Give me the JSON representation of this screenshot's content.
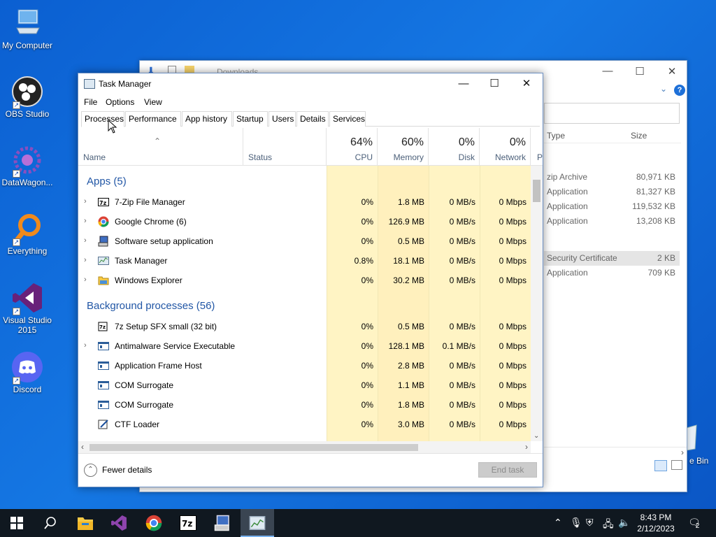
{
  "desktop": {
    "icons": [
      {
        "label": "My Computer"
      },
      {
        "label": "OBS Studio"
      },
      {
        "label": "DataWagon..."
      },
      {
        "label": "Everything"
      },
      {
        "label": "Visual Studio 2015"
      },
      {
        "label": "Discord"
      }
    ],
    "recycle_bin_label": "e Bin"
  },
  "explorer": {
    "breadcrumb": "Downloads",
    "columns": {
      "type": "Type",
      "size": "Size"
    },
    "rows": [
      {
        "type": "zip Archive",
        "size": "80,971 KB"
      },
      {
        "type": "Application",
        "size": "81,327 KB"
      },
      {
        "type": "Application",
        "size": "119,532 KB"
      },
      {
        "type": "Application",
        "size": "13,208 KB"
      },
      {
        "type": "Security Certificate",
        "size": "2 KB"
      },
      {
        "type": "Application",
        "size": "709 KB"
      }
    ]
  },
  "taskmanager": {
    "title": "Task Manager",
    "menu": [
      "File",
      "Options",
      "View"
    ],
    "tabs": [
      "Processes",
      "Performance",
      "App history",
      "Startup",
      "Users",
      "Details",
      "Services"
    ],
    "active_tab": "Processes",
    "headers": {
      "name": "Name",
      "status": "Status",
      "cpu_pct": "64%",
      "cpu": "CPU",
      "mem_pct": "60%",
      "mem": "Memory",
      "disk_pct": "0%",
      "disk": "Disk",
      "net_pct": "0%",
      "net": "Network",
      "power": "P"
    },
    "groups": {
      "apps": "Apps (5)",
      "background": "Background processes (56)"
    },
    "apps": [
      {
        "name": "7-Zip File Manager",
        "cpu": "0%",
        "mem": "1.8 MB",
        "disk": "0 MB/s",
        "net": "0 Mbps"
      },
      {
        "name": "Google Chrome (6)",
        "cpu": "0%",
        "mem": "126.9 MB",
        "disk": "0 MB/s",
        "net": "0 Mbps"
      },
      {
        "name": "Software setup application",
        "cpu": "0%",
        "mem": "0.5 MB",
        "disk": "0 MB/s",
        "net": "0 Mbps"
      },
      {
        "name": "Task Manager",
        "cpu": "0.8%",
        "mem": "18.1 MB",
        "disk": "0 MB/s",
        "net": "0 Mbps"
      },
      {
        "name": "Windows Explorer",
        "cpu": "0%",
        "mem": "30.2 MB",
        "disk": "0 MB/s",
        "net": "0 Mbps"
      }
    ],
    "background": [
      {
        "name": "7z Setup SFX small (32 bit)",
        "cpu": "0%",
        "mem": "0.5 MB",
        "disk": "0 MB/s",
        "net": "0 Mbps"
      },
      {
        "name": "Antimalware Service Executable",
        "cpu": "0%",
        "mem": "128.1 MB",
        "disk": "0.1 MB/s",
        "net": "0 Mbps"
      },
      {
        "name": "Application Frame Host",
        "cpu": "0%",
        "mem": "2.8 MB",
        "disk": "0 MB/s",
        "net": "0 Mbps"
      },
      {
        "name": "COM Surrogate",
        "cpu": "0%",
        "mem": "1.1 MB",
        "disk": "0 MB/s",
        "net": "0 Mbps"
      },
      {
        "name": "COM Surrogate",
        "cpu": "0%",
        "mem": "1.8 MB",
        "disk": "0 MB/s",
        "net": "0 Mbps"
      },
      {
        "name": "CTF Loader",
        "cpu": "0%",
        "mem": "3.0 MB",
        "disk": "0 MB/s",
        "net": "0 Mbps"
      }
    ],
    "footer": {
      "fewer_details": "Fewer details",
      "end_task": "End task"
    }
  },
  "taskbar": {
    "time": "8:43 PM",
    "date": "2/12/2023",
    "notifications": "2",
    "pinned": [
      "start-icon",
      "search-icon",
      "file-explorer-icon",
      "visual-studio-icon",
      "chrome-icon",
      "7zip-icon",
      "setup-icon",
      "task-manager-icon"
    ]
  },
  "colors": {
    "accent": "#2156a5",
    "cpu_col": "#fff4c4",
    "mem_col": "#ffe9a8",
    "desktop": "#1577e3"
  }
}
